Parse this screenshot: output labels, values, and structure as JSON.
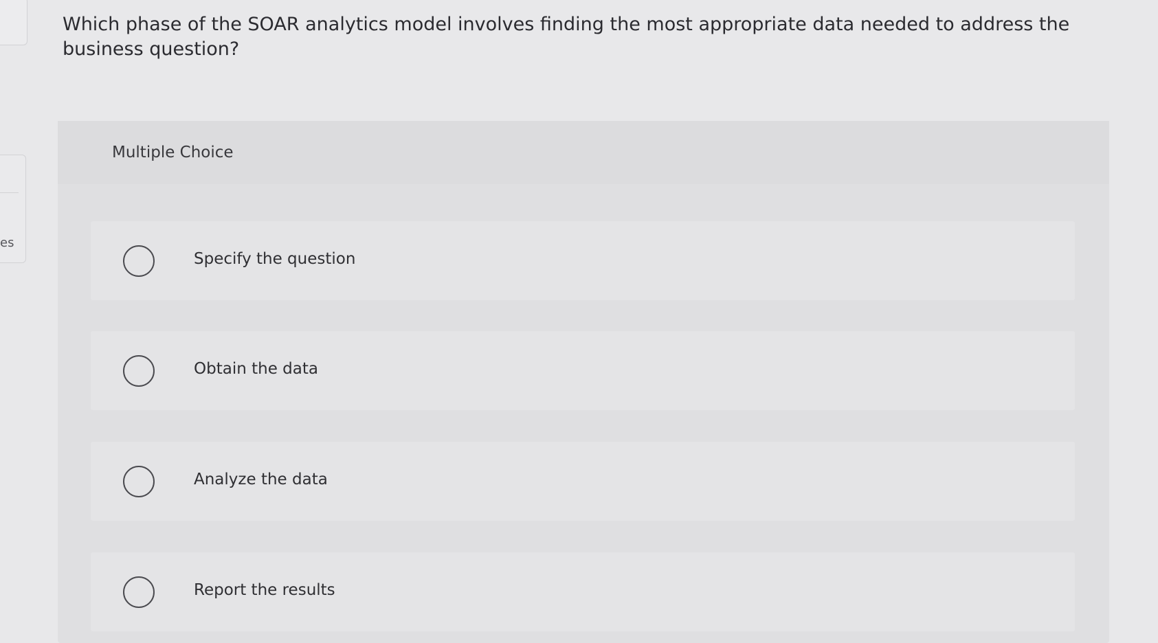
{
  "side_tab": {
    "text": "es"
  },
  "question": {
    "text": "Which phase of the SOAR analytics model involves finding the most appropriate data needed to address the business question?"
  },
  "multiple_choice": {
    "title": "Multiple Choice",
    "options": [
      {
        "label": "Specify the question",
        "selected": false
      },
      {
        "label": "Obtain the data",
        "selected": false
      },
      {
        "label": "Analyze the data",
        "selected": false
      },
      {
        "label": "Report the results",
        "selected": false
      }
    ]
  }
}
